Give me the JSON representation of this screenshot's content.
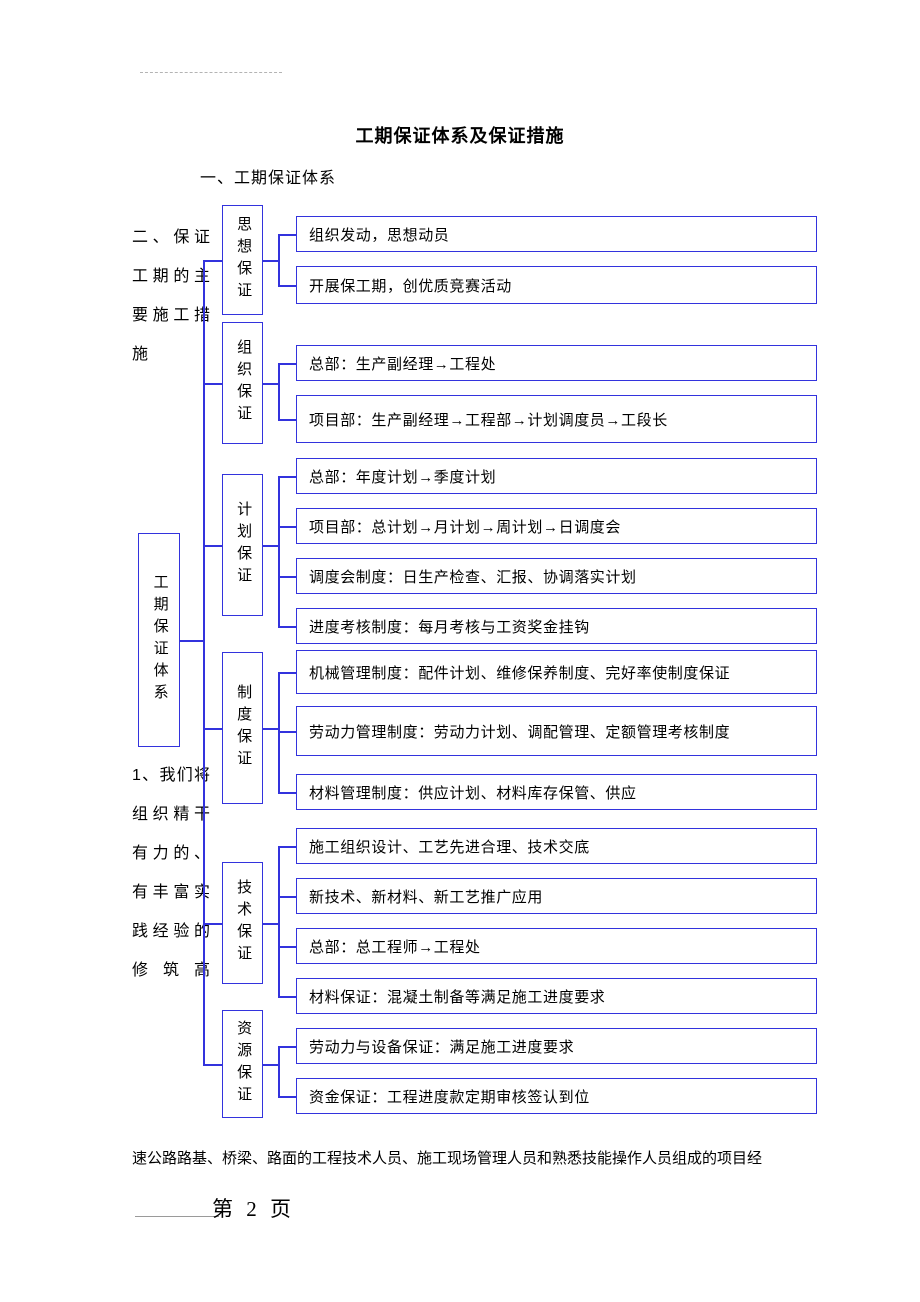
{
  "document": {
    "title": "工期保证体系及保证措施",
    "section_heading": "一、工期保证体系",
    "header_rule": "dashed-rule",
    "footer": {
      "page_label": "第 2 页"
    },
    "body_text_left_upper": "二、保证工期的主要施工措施",
    "body_text_left_lower": "1、我们将组织精干有力的、有丰富实践经验的修筑高",
    "body_text_bottom": "速公路路基、桥梁、路面的工程技术人员、施工现场管理人员和熟悉技能操作人员组成的项目经"
  },
  "diagram": {
    "root": {
      "label": "工期保证体系"
    },
    "categories": [
      {
        "label": "思想保证"
      },
      {
        "label": "组织保证"
      },
      {
        "label": "计划保证"
      },
      {
        "label": "制度保证"
      },
      {
        "label": "技术保证"
      },
      {
        "label": "资源保证"
      }
    ],
    "items": [
      {
        "text": "组织发动，思想动员"
      },
      {
        "text": "开展保工期，创优质竞赛活动"
      },
      {
        "text": "总部：生产副经理→工程处"
      },
      {
        "text": "项目部：生产副经理→工程部→计划调度员→工段长"
      },
      {
        "text": "总部：年度计划→季度计划"
      },
      {
        "text": "项目部：总计划→月计划→周计划→日调度会"
      },
      {
        "text": "调度会制度：日生产检查、汇报、协调落实计划"
      },
      {
        "text": "进度考核制度：每月考核与工资奖金挂钩"
      },
      {
        "text": "机械管理制度：配件计划、维修保养制度、完好率使制度保证"
      },
      {
        "text": "劳动力管理制度：劳动力计划、调配管理、定额管理考核制度"
      },
      {
        "text": "材料管理制度：供应计划、材料库存保管、供应"
      },
      {
        "text": "施工组织设计、工艺先进合理、技术交底"
      },
      {
        "text": "新技术、新材料、新工艺推广应用"
      },
      {
        "text": "总部：总工程师→工程处"
      },
      {
        "text": "材料保证：混凝土制备等满足施工进度要求"
      },
      {
        "text": "劳动力与设备保证：满足施工进度要求"
      },
      {
        "text": "资金保证：工程进度款定期审核签认到位"
      }
    ],
    "colors": {
      "line": "#3333dd",
      "text": "#000000",
      "background": "#ffffff"
    }
  }
}
